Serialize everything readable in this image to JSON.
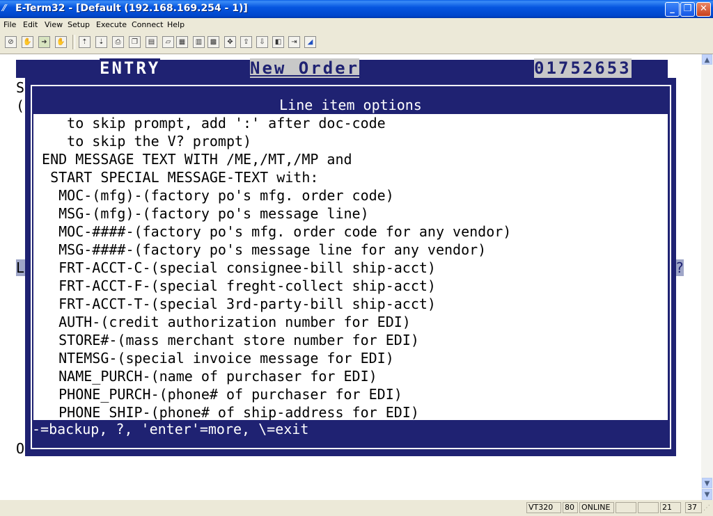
{
  "window": {
    "title": "E-Term32 - [Default (192.168.169.254 - 1)]"
  },
  "menu": [
    "File",
    "Edit",
    "View",
    "Setup",
    "Execute",
    "Connect",
    "Help"
  ],
  "terminal": {
    "header": {
      "mode": "ENTRY",
      "screen": "New Order",
      "order_number": "01752653"
    },
    "background_chars": {
      "s": "S",
      "paren": "(",
      "l": "L",
      "q": "?",
      "o": "O"
    },
    "dialog": {
      "title": "Line item options",
      "lines": [
        "    to skip prompt, add ':' after doc-code",
        "    to skip the V? prompt)",
        " END MESSAGE TEXT WITH /ME,/MT,/MP and",
        "  START SPECIAL MESSAGE-TEXT with:",
        "   MOC-(mfg)-(factory po's mfg. order code)",
        "   MSG-(mfg)-(factory po's message line)",
        "   MOC-####-(factory po's mfg. order code for any vendor)",
        "   MSG-####-(factory po's message line for any vendor)",
        "   FRT-ACCT-C-(special consignee-bill ship-acct)",
        "   FRT-ACCT-F-(special freght-collect ship-acct)",
        "   FRT-ACCT-T-(special 3rd-party-bill ship-acct)",
        "   AUTH-(credit authorization number for EDI)",
        "   STORE#-(mass merchant store number for EDI)",
        "   NTEMSG-(special invoice message for EDI)",
        "   NAME_PURCH-(name of purchaser for EDI)",
        "   PHONE_PURCH-(phone# of purchaser for EDI)",
        "   PHONE_SHIP-(phone# of ship-address for EDI)"
      ],
      "footer": "-=backup, ?, 'enter'=more, \\=exit"
    }
  },
  "status": {
    "terminal_type": "VT320",
    "columns": "80",
    "connection": "ONLINE",
    "row": "21",
    "col": "37"
  }
}
